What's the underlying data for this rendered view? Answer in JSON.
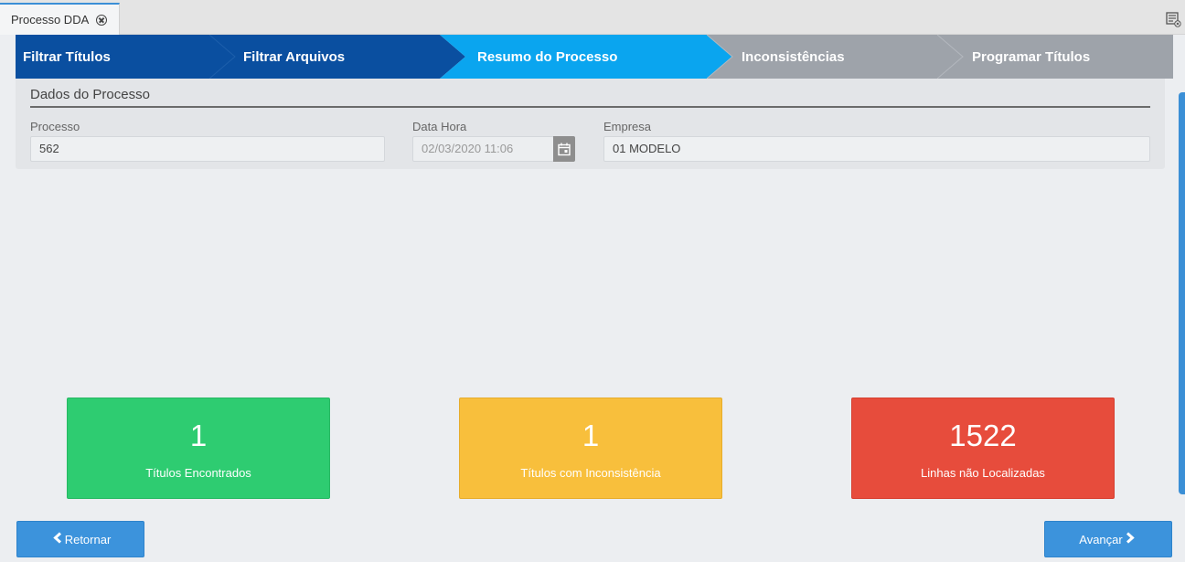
{
  "tab": {
    "title": "Processo DDA"
  },
  "steps": [
    {
      "label": "Filtrar Títulos",
      "state": "done"
    },
    {
      "label": "Filtrar Arquivos",
      "state": "done"
    },
    {
      "label": "Resumo do Processo",
      "state": "active"
    },
    {
      "label": "Inconsistências",
      "state": "pending"
    },
    {
      "label": "Programar Títulos",
      "state": "pending"
    }
  ],
  "colors": {
    "done": "#0a4fa0",
    "active": "#0aa5ef",
    "pending": "#9ea3aa",
    "green": "#2ecc71",
    "yellow": "#f8bf3c",
    "red": "#e74c3c",
    "button": "#3c93dc"
  },
  "panel": {
    "title": "Dados do Processo",
    "fields": {
      "processo": {
        "label": "Processo",
        "value": "562"
      },
      "data_hora": {
        "label": "Data Hora",
        "value": "02/03/2020 11:06"
      },
      "empresa": {
        "label": "Empresa",
        "value": "01 MODELO"
      }
    }
  },
  "summary": [
    {
      "value": "1",
      "caption": "Títulos Encontrados"
    },
    {
      "value": "1",
      "caption": "Títulos com Inconsistência"
    },
    {
      "value": "1522",
      "caption": "Linhas não Localizadas"
    }
  ],
  "buttons": {
    "back": "Retornar",
    "next": "Avançar"
  },
  "icons": {
    "tab_close": "close-circle-icon",
    "tab_menu": "window-list-icon",
    "date": "calendar-icon",
    "back": "chevron-left-icon",
    "next": "chevron-right-icon"
  }
}
